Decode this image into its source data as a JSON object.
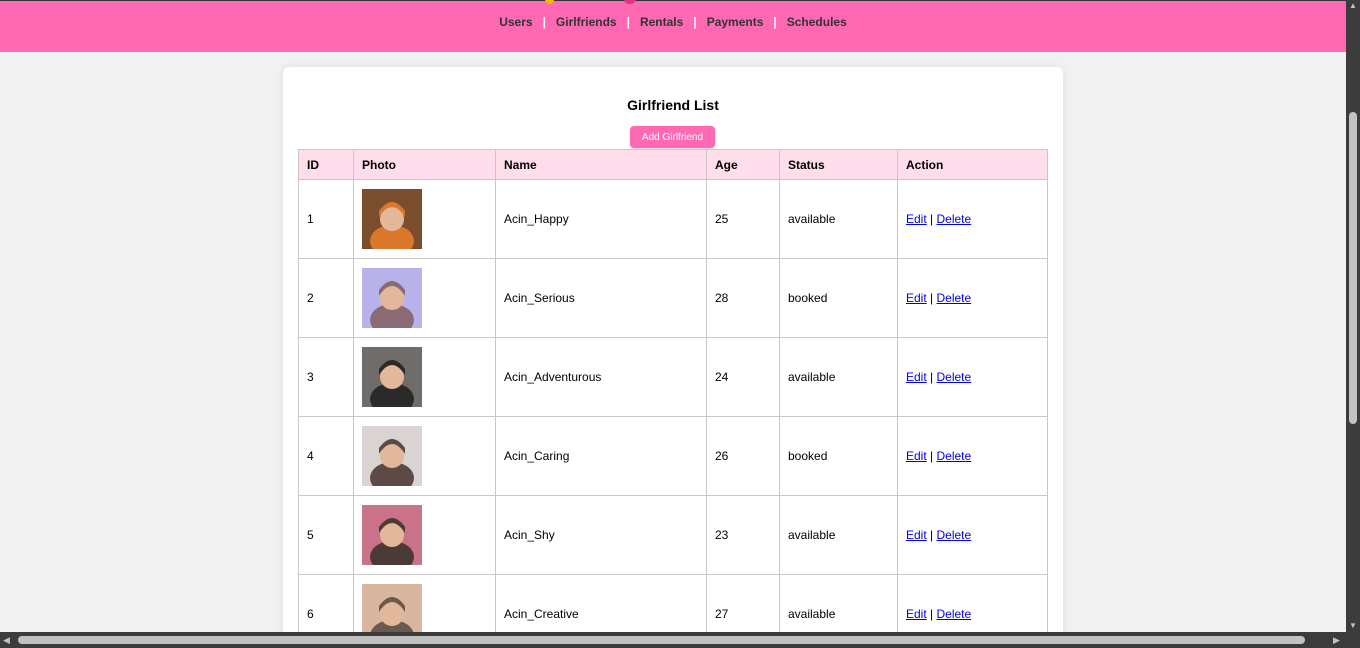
{
  "nav": {
    "items": [
      "Users",
      "Girlfriends",
      "Rentals",
      "Payments",
      "Schedules"
    ],
    "separator": "|"
  },
  "page": {
    "title": "Girlfriend List",
    "add_button": "Add Girlfriend"
  },
  "table": {
    "headers": [
      "ID",
      "Photo",
      "Name",
      "Age",
      "Status",
      "Action"
    ],
    "edit_label": "Edit",
    "delete_label": "Delete",
    "action_separator": "|",
    "rows": [
      {
        "id": "1",
        "name": "Acin_Happy",
        "age": "25",
        "status": "available",
        "photo_bg": "#7a4e2c",
        "photo_fg": "#d9772a"
      },
      {
        "id": "2",
        "name": "Acin_Serious",
        "age": "28",
        "status": "booked",
        "photo_bg": "#b7b3ea",
        "photo_fg": "#8a6a73"
      },
      {
        "id": "3",
        "name": "Acin_Adventurous",
        "age": "24",
        "status": "available",
        "photo_bg": "#6f6c69",
        "photo_fg": "#2b2a2a"
      },
      {
        "id": "4",
        "name": "Acin_Caring",
        "age": "26",
        "status": "booked",
        "photo_bg": "#d9d4d1",
        "photo_fg": "#5b4a45"
      },
      {
        "id": "5",
        "name": "Acin_Shy",
        "age": "23",
        "status": "available",
        "photo_bg": "#c9728a",
        "photo_fg": "#4b3a38"
      },
      {
        "id": "6",
        "name": "Acin_Creative",
        "age": "27",
        "status": "available",
        "photo_bg": "#d8b6a0",
        "photo_fg": "#6b5a4c"
      }
    ]
  },
  "colors": {
    "accent": "#ff69b4",
    "header_row": "#ffddeb",
    "link": "#0000ee"
  }
}
